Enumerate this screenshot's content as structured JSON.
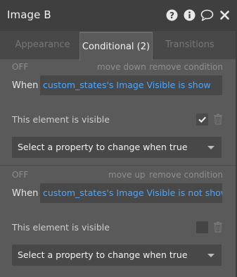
{
  "header": {
    "title": "Image B",
    "icons": [
      "help-icon",
      "info-icon",
      "comment-icon",
      "close-icon"
    ]
  },
  "tabs": [
    {
      "label": "Appearance",
      "active": false
    },
    {
      "label": "Conditional (2)",
      "active": true
    },
    {
      "label": "Transitions",
      "active": false
    }
  ],
  "conditions": [
    {
      "status": "OFF",
      "move_label": "move down",
      "remove_label": "remove condition",
      "when_label": "When",
      "expression": "custom_states's Image Visible is show",
      "property_label": "This element is visible",
      "checked": true,
      "select_placeholder": "Select a property to change when true"
    },
    {
      "status": "OFF",
      "move_label": "move up",
      "remove_label": "remove condition",
      "when_label": "When",
      "expression": "custom_states's Image Visible is not show",
      "property_label": "This element is visible",
      "checked": false,
      "select_placeholder": "Select a property to change when true"
    }
  ],
  "colors": {
    "accent_link": "#4aa8ff",
    "panel_bg": "#5a5a5a",
    "header_bg": "#3f3f3f"
  }
}
